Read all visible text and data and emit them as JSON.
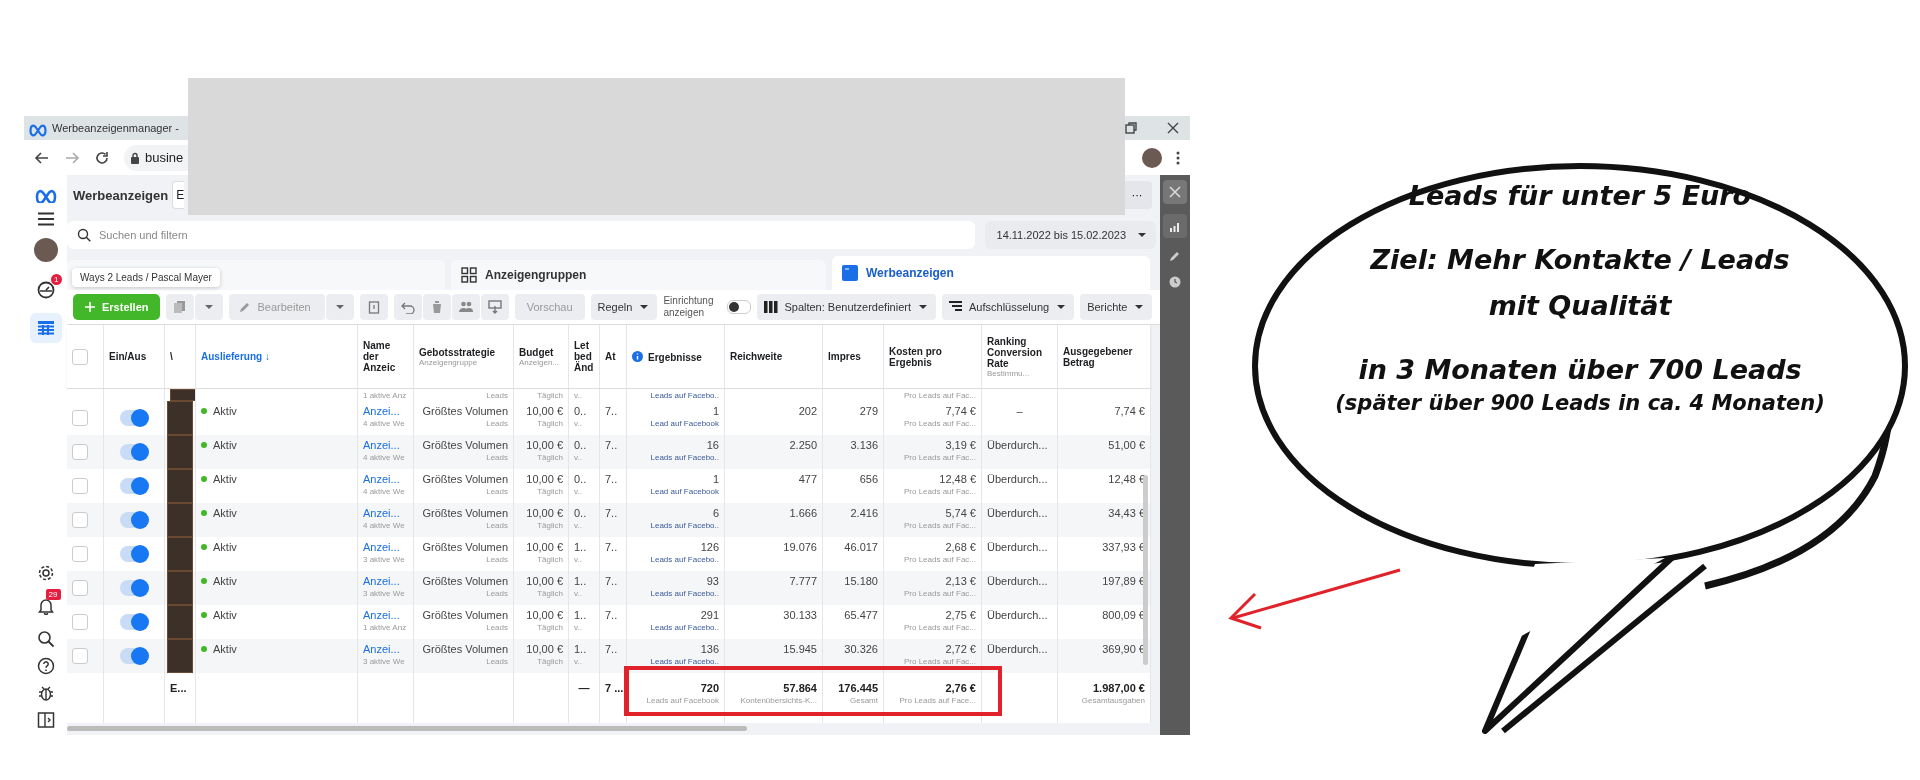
{
  "browser": {
    "tab_title": "Werbeanzeigenmanager -",
    "address": "busine"
  },
  "nav": {
    "alerts_badge": "1",
    "notifications_badge": "29"
  },
  "app": {
    "title": "Werbeanzeigen",
    "account_selector": "E",
    "more": "···"
  },
  "search": {
    "placeholder": "Suchen und filtern",
    "date_range": "14.11.2022 bis 15.02.2023"
  },
  "tabs": [
    {
      "selected": false
    },
    {
      "label": "Anzeigengruppen",
      "selected": false
    },
    {
      "label": "Werbeanzeigen",
      "selected": true
    }
  ],
  "tooltip": "Ways 2 Leads / Pascal Mayer",
  "toolbar": {
    "create": "Erstellen",
    "edit": "Bearbeiten",
    "preview": "Vorschau",
    "rules": "Regeln",
    "setup_label": "Einrichtung anzeigen",
    "setup_on": false,
    "columns": "Spalten: Benutzerdefiniert",
    "breakdown": "Aufschlüsselung",
    "reports": "Berichte"
  },
  "table": {
    "select_all_checked": false,
    "columns": [
      {
        "label": "Ein/Aus",
        "sorted": false,
        "info": false
      },
      {
        "label": "\\",
        "sorted": false,
        "info": false
      },
      {
        "label": "Auslieferung ↓",
        "sorted": true,
        "info": false
      },
      {
        "label": "Name der Anzeic",
        "sorted": false,
        "info": false
      },
      {
        "label": "Gebotsstrategie",
        "sublabel": "Anzeigengruppe",
        "sorted": false,
        "info": false
      },
      {
        "label": "Budget",
        "sublabel": "Anzeigen...",
        "sorted": false,
        "info": false
      },
      {
        "label": "Let bed Änd",
        "sorted": false,
        "info": false
      },
      {
        "label": "At",
        "sorted": false,
        "info": false
      },
      {
        "label": "Ergebnisse",
        "sorted": false,
        "info": true
      },
      {
        "label": "Reichweite",
        "sorted": false,
        "info": false
      },
      {
        "label": "Impres",
        "sorted": false,
        "info": false
      },
      {
        "label": "Kosten pro Ergebnis",
        "sorted": false,
        "info": false
      },
      {
        "label": "Ranking Conversion Rate",
        "sublabel": "Bestimmu...",
        "sorted": false,
        "info": false
      },
      {
        "label": "Ausgegebener Betrag",
        "sorted": false,
        "info": false
      }
    ],
    "partial_row": {
      "name_sub": "1 aktive Anz",
      "bid_sub": "Leads",
      "budget_sub": "Täglich",
      "change_sub": "v..",
      "results_sub": "Leads auf Facebo..",
      "cost_sub": "Pro Leads auf Fac..."
    },
    "rows": [
      {
        "checked": false,
        "on": true,
        "delivery": "Aktiv",
        "name": "Anzei...",
        "name_sub": "4 aktive We",
        "bid": "Größtes Volumen",
        "bid_sub": "Leads",
        "budget": "10,00 €",
        "budget_sub": "Täglich",
        "change": "0..",
        "change_sub": "v..",
        "attribution": "7..",
        "results": "1",
        "results_sub": "Lead auf Facebook",
        "reach": "202",
        "impressions": "279",
        "cost": "7,74 €",
        "cost_sub": "Pro Leads auf Fac...",
        "ranking": "–",
        "spent": "7,74 €"
      },
      {
        "checked": false,
        "on": true,
        "delivery": "Aktiv",
        "name": "Anzei...",
        "name_sub": "4 aktive We",
        "bid": "Größtes Volumen",
        "bid_sub": "Leads",
        "budget": "10,00 €",
        "budget_sub": "Täglich",
        "change": "0..",
        "change_sub": "v..",
        "attribution": "7..",
        "results": "16",
        "results_sub": "Leads auf Facebo..",
        "reach": "2.250",
        "impressions": "3.136",
        "cost": "3,19 €",
        "cost_sub": "Pro Leads auf Fac...",
        "ranking": "Überdurch...",
        "spent": "51,00 €"
      },
      {
        "checked": false,
        "on": true,
        "delivery": "Aktiv",
        "name": "Anzei...",
        "name_sub": "4 aktive We",
        "bid": "Größtes Volumen",
        "bid_sub": "Leads",
        "budget": "10,00 €",
        "budget_sub": "Täglich",
        "change": "0..",
        "change_sub": "v..",
        "attribution": "7..",
        "results": "1",
        "results_sub": "Lead auf Facebook",
        "reach": "477",
        "impressions": "656",
        "cost": "12,48 €",
        "cost_sub": "Pro Leads auf Fac...",
        "ranking": "Überdurch...",
        "spent": "12,48 €"
      },
      {
        "checked": false,
        "on": true,
        "delivery": "Aktiv",
        "name": "Anzei...",
        "name_sub": "4 aktive We",
        "bid": "Größtes Volumen",
        "bid_sub": "Leads",
        "budget": "10,00 €",
        "budget_sub": "Täglich",
        "change": "0..",
        "change_sub": "v..",
        "attribution": "7..",
        "results": "6",
        "results_sub": "Leads auf Facebo..",
        "reach": "1.666",
        "impressions": "2.416",
        "cost": "5,74 €",
        "cost_sub": "Pro Leads auf Fac...",
        "ranking": "Überdurch...",
        "spent": "34,43 €"
      },
      {
        "checked": false,
        "on": true,
        "delivery": "Aktiv",
        "name": "Anzei...",
        "name_sub": "3 aktive We",
        "bid": "Größtes Volumen",
        "bid_sub": "Leads",
        "budget": "10,00 €",
        "budget_sub": "Täglich",
        "change": "1..",
        "change_sub": "v..",
        "attribution": "7..",
        "results": "126",
        "results_sub": "Leads auf Facebo..",
        "reach": "19.076",
        "impressions": "46.017",
        "cost": "2,68 €",
        "cost_sub": "Pro Leads auf Fac...",
        "ranking": "Überdurch...",
        "spent": "337,93 €"
      },
      {
        "checked": false,
        "on": true,
        "delivery": "Aktiv",
        "name": "Anzei...",
        "name_sub": "3 aktive We",
        "bid": "Größtes Volumen",
        "bid_sub": "Leads",
        "budget": "10,00 €",
        "budget_sub": "Täglich",
        "change": "1..",
        "change_sub": "v..",
        "attribution": "7..",
        "results": "93",
        "results_sub": "Leads auf Facebo..",
        "reach": "7.777",
        "impressions": "15.180",
        "cost": "2,13 €",
        "cost_sub": "Pro Leads auf Fac...",
        "ranking": "Überdurch...",
        "spent": "197,89 €"
      },
      {
        "checked": false,
        "on": true,
        "delivery": "Aktiv",
        "name": "Anzei...",
        "name_sub": "1 aktive Anz",
        "bid": "Größtes Volumen",
        "bid_sub": "Leads",
        "budget": "10,00 €",
        "budget_sub": "Täglich",
        "change": "1..",
        "change_sub": "v..",
        "attribution": "7..",
        "results": "291",
        "results_sub": "Leads auf Facebo..",
        "reach": "30.133",
        "impressions": "65.477",
        "cost": "2,75 €",
        "cost_sub": "Pro Leads auf Fac...",
        "ranking": "Überdurch...",
        "spent": "800,09 €"
      },
      {
        "checked": false,
        "on": true,
        "delivery": "Aktiv",
        "name": "Anzei...",
        "name_sub": "3 aktive We",
        "bid": "Größtes Volumen",
        "bid_sub": "Leads",
        "budget": "10,00 €",
        "budget_sub": "Täglich",
        "change": "1..",
        "change_sub": "v..",
        "attribution": "7..",
        "results": "136",
        "results_sub": "Leads auf Facebo..",
        "reach": "15.945",
        "impressions": "30.326",
        "cost": "2,72 €",
        "cost_sub": "Pro Leads auf Fac...",
        "ranking": "Überdurch...",
        "spent": "369,90 €"
      }
    ],
    "totals": {
      "label": "E...",
      "change": "—",
      "attribution": "7 ...",
      "results": "720",
      "results_sub": "Leads auf Facebook",
      "reach": "57.864",
      "reach_sub": "Kontenübersichts-K...",
      "impressions": "176.445",
      "impressions_sub": "Gesamt",
      "cost": "2,76 €",
      "cost_sub": "Pro Leads auf Face...",
      "spent": "1.987,00 €",
      "spent_sub": "Gesamtausgaben"
    }
  },
  "bubble": {
    "paragraphs": [
      [
        {
          "text": "Leads für unter 5 Euro",
          "kind": "main"
        }
      ],
      [
        {
          "text": "Ziel: Mehr Kontakte / Leads",
          "kind": "main"
        },
        {
          "text": "mit Qualität",
          "kind": "main"
        }
      ],
      [
        {
          "text": "in 3 Monaten über 700 Leads",
          "kind": "main"
        },
        {
          "text": "(später über 900 Leads in ca. 4 Monaten)",
          "kind": "note"
        }
      ]
    ]
  }
}
